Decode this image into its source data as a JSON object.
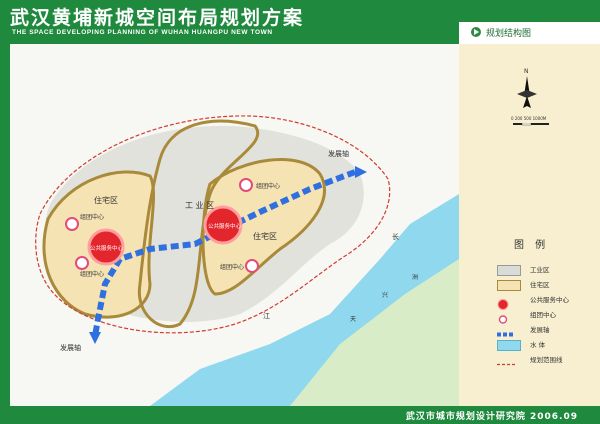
{
  "header": {
    "title_cn": "武汉黄埔新城空间布局规划方案",
    "title_en": "THE SPACE DEVELOPING PLANNING OF WUHAN HUANGPU NEW TOWN"
  },
  "panel": {
    "tab_label": "规划结构图",
    "north_label": "N",
    "scale_label": "0   200  500       1000M"
  },
  "map_labels": {
    "residential_north": "住宅区",
    "residential_east": "住宅区",
    "industrial": "工  业  区",
    "public_center_main": "公共服务中心",
    "public_center_west": "公共服务中心",
    "group_center_1": "组团中心",
    "group_center_2": "组团中心",
    "group_center_3": "组团中心",
    "group_center_4": "组团中心",
    "axis_east": "发展轴",
    "axis_south": "发展轴",
    "river_1": "长",
    "river_2": "江",
    "river_3": "天",
    "river_4": "兴",
    "river_5": "洲"
  },
  "legend": {
    "title": "图  例",
    "items": [
      {
        "label": "工业区",
        "color": "#d9dcd6"
      },
      {
        "label": "住宅区",
        "color": "#f6e3b4"
      },
      {
        "label": "公共服务中心",
        "color": "#e2262c"
      },
      {
        "label": "组团中心",
        "color": "#e24c7a"
      },
      {
        "label": "发展轴",
        "color": "#2f6fe0"
      },
      {
        "label": "水  体",
        "color": "#8fd8ee"
      },
      {
        "label": "规划范围线",
        "color": "#d23b2e"
      }
    ]
  },
  "footer": {
    "text": "武汉市城市规划设计研究院 2006.09"
  }
}
